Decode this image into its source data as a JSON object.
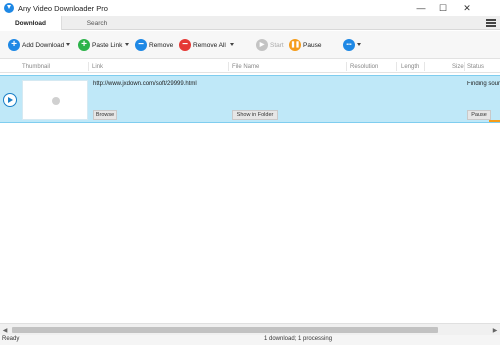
{
  "window": {
    "title": "Any Video Downloader Pro",
    "minimize_glyph": "—",
    "maximize_glyph": "☐",
    "close_glyph": "✕"
  },
  "tabs": [
    {
      "label": "Download",
      "active": true
    },
    {
      "label": "Search",
      "active": false
    }
  ],
  "toolbar": {
    "add_download": "Add Download",
    "paste_link": "Paste Link",
    "remove": "Remove",
    "remove_all": "Remove All",
    "start": "Start",
    "pause": "Pause",
    "more_glyph": "•••"
  },
  "columns": {
    "thumbnail": "Thumbnail",
    "link": "Link",
    "file_name": "File Name",
    "resolution": "Resolution",
    "length": "Length",
    "size": "Size",
    "status": "Status"
  },
  "download_row": {
    "link": "http://www.jxdown.com/soft/29999.html",
    "status": "Finding source",
    "browse": "Browse",
    "show_in_folder": "Show in Folder",
    "pause": "Pause"
  },
  "scrollbar": {
    "left_arrow": "◀",
    "right_arrow": "▶"
  },
  "status": {
    "ready": "Ready",
    "summary": "1 download; 1 processing"
  },
  "colors": {
    "accent_blue": "#1e88e5",
    "add_green": "#2db34a",
    "remove_red": "#e53935",
    "pause_orange": "#f59c1a",
    "selected_row": "#bfe8f8"
  },
  "icons": [
    "download-arrow-icon",
    "plus-icon",
    "minus-icon",
    "play-icon",
    "pause-icon",
    "more-icon",
    "menu-icon"
  ]
}
